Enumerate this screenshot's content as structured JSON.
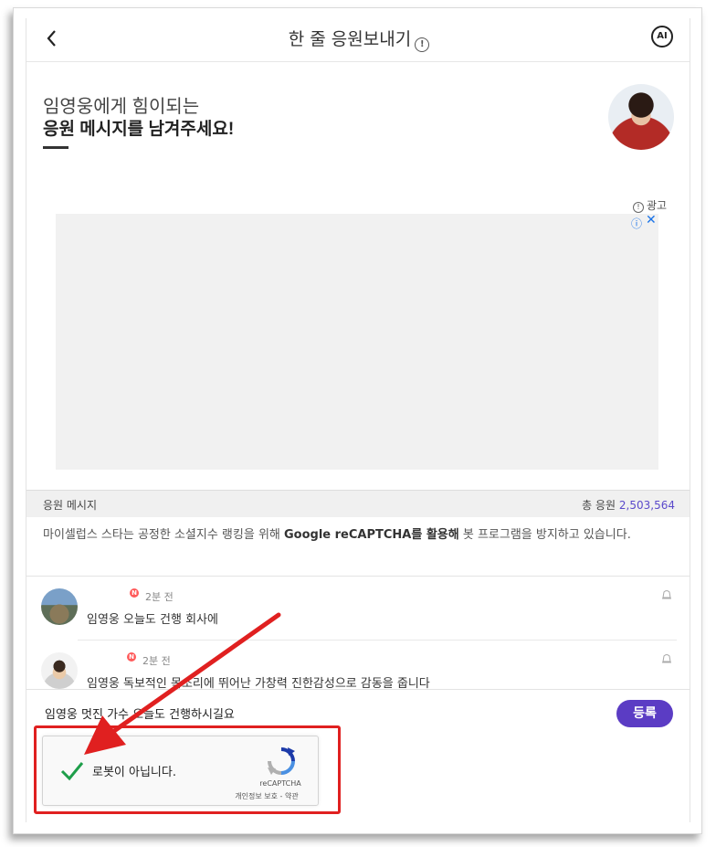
{
  "header": {
    "title": "한 줄 응원보내기",
    "info_glyph": "!",
    "ai_glyph": "AI"
  },
  "hero": {
    "line1": "임영웅에게 힘이되는",
    "line2": "응원 메시지를 남겨주세요!"
  },
  "ad": {
    "label": "광고",
    "info_glyph": "ⓘ",
    "close_glyph": "✕"
  },
  "section": {
    "title": "응원 메시지",
    "total_label": "총 응원",
    "total_count": "2,503,564"
  },
  "notice": {
    "text_before": "마이셀럽스 스타는 공정한 소셜지수 랭킹을 위해 ",
    "highlight": "Google reCAPTCHA를 활용해",
    "text_after": " 봇 프로그램을 방지하고 있습니다."
  },
  "comments": [
    {
      "badge": "N",
      "time": "2분 전",
      "text": "임영웅 오늘도 건행 회사에"
    },
    {
      "badge": "N",
      "time": "2분 전",
      "text": "임영웅 독보적인 목소리에 뛰어난 가창력 진한감성으로 감동을 줍니다"
    }
  ],
  "composer": {
    "value": "임영웅 멋진 가수 오늘도 건행하시길요",
    "submit_label": "등록"
  },
  "recaptcha": {
    "label": "로봇이 아닙니다.",
    "brand": "reCAPTCHA",
    "links": "개인정보 보호 - 약관"
  },
  "colors": {
    "accent": "#5b3cc4",
    "highlight_box": "#e02020",
    "check": "#1e9e4a"
  }
}
